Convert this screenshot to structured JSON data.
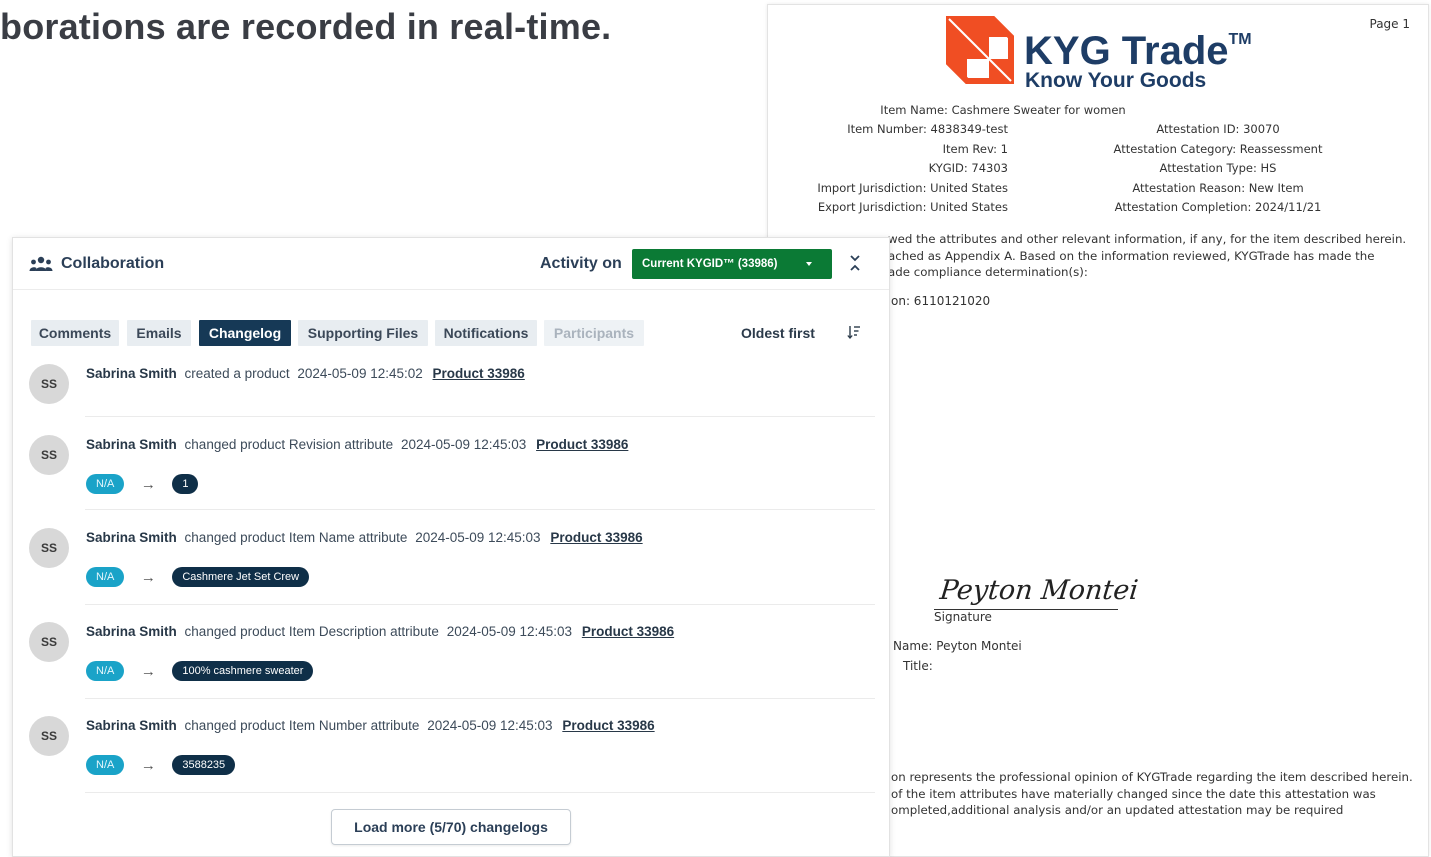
{
  "headline": "borations are recorded in real-time.",
  "document": {
    "page_label": "Page 1",
    "logo": {
      "title": "KYG Trade",
      "tm": "TM",
      "tagline": "Know Your Goods"
    },
    "item_name": "Item Name: Cashmere Sweater for women",
    "left_fields": [
      "Item Number: 4838349-test",
      "Item Rev: 1",
      "KYGID: 74303",
      "Import Jurisdiction: United States",
      "Export Jurisdiction: United States"
    ],
    "right_fields": [
      "Attestation ID: 30070",
      "Attestation Category: Reassessment",
      "Attestation Type: HS",
      "Attestation Reason: New Item",
      "Attestation Completion: 2024/11/21"
    ],
    "para1": [
      "wed the attributes and other relevant information, if any, for the item described herein.",
      "ached as Appendix A. Based on the information reviewed, KYGTrade has made the",
      "ade compliance determination(s):"
    ],
    "classification": "on: 6110121020",
    "signature_script": "Peyton Montei",
    "signature_label": "Signature",
    "name_field": "Name: Peyton Montei",
    "title_field": "Title:",
    "para2": [
      "on represents the professional opinion of KYGTrade regarding the item described herein.",
      "of the item attributes have materially changed since the date this attestation was",
      "ompleted,additional analysis and/or an updated attestation may be required"
    ]
  },
  "panel": {
    "title": "Collaboration",
    "activity_label": "Activity on",
    "kygid_selected": "Current KYGID™ (33986)",
    "tabs": [
      "Comments",
      "Emails",
      "Changelog",
      "Supporting Files",
      "Notifications",
      "Participants"
    ],
    "active_tab": "Changelog",
    "sort_label": "Oldest first",
    "load_more": "Load more (5/70) changelogs",
    "entries": [
      {
        "initials": "SS",
        "user": "Sabrina Smith",
        "action": "created a product",
        "time": "2024-05-09 12:45:02",
        "link": "Product 33986"
      },
      {
        "initials": "SS",
        "user": "Sabrina Smith",
        "action": "changed product Revision attribute",
        "time": "2024-05-09 12:45:03",
        "link": "Product 33986",
        "old": "N/A",
        "arrow": "→",
        "new": "1"
      },
      {
        "initials": "SS",
        "user": "Sabrina Smith",
        "action": "changed product Item Name attribute",
        "time": "2024-05-09 12:45:03",
        "link": "Product 33986",
        "old": "N/A",
        "arrow": "→",
        "new": "Cashmere Jet Set Crew"
      },
      {
        "initials": "SS",
        "user": "Sabrina Smith",
        "action": "changed product Item Description attribute",
        "time": "2024-05-09 12:45:03",
        "link": "Product 33986",
        "old": "N/A",
        "arrow": "→",
        "new": "100% cashmere sweater"
      },
      {
        "initials": "SS",
        "user": "Sabrina Smith",
        "action": "changed product Item Number attribute",
        "time": "2024-05-09 12:45:03",
        "link": "Product 33986",
        "old": "N/A",
        "arrow": "→",
        "new": "3588235"
      }
    ]
  },
  "colors": {
    "accent_green": "#0b7a35",
    "navy": "#163956",
    "teal": "#1aa3c8",
    "brand": "#1e3d66",
    "logo_orange": "#f04e23"
  }
}
